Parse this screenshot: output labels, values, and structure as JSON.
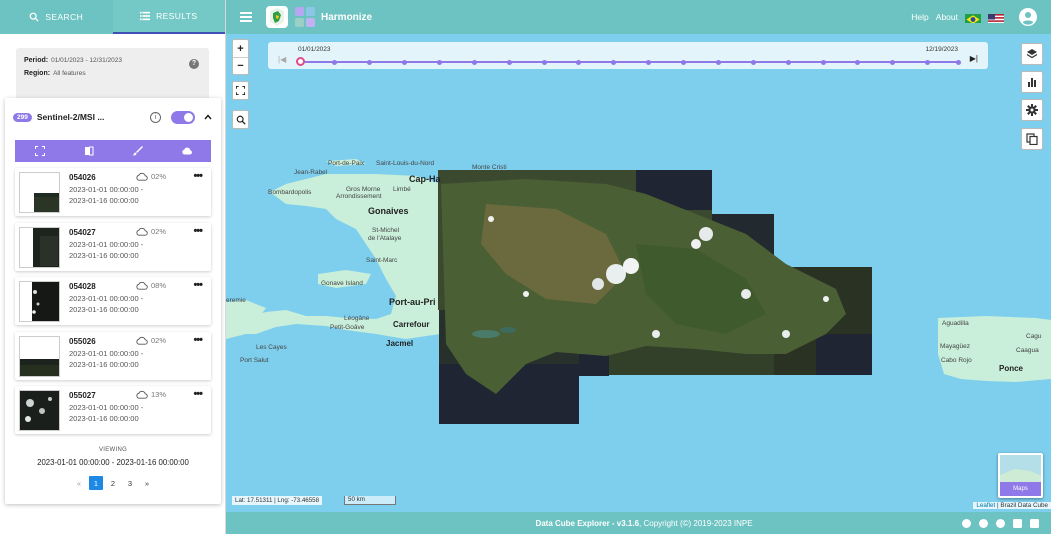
{
  "sidebar": {
    "tabs": [
      {
        "label": "SEARCH",
        "icon": "search-icon"
      },
      {
        "label": "RESULTS",
        "icon": "list-icon"
      }
    ],
    "summary": {
      "period_label": "Period:",
      "period_value": "01/01/2023 - 12/31/2023",
      "region_label": "Region:",
      "region_value": "All features"
    },
    "collection": {
      "count": "299",
      "name": "Sentinel-2/MSI ...",
      "toggle_on": true
    },
    "scenes": [
      {
        "id": "054026",
        "cloud": "02%",
        "start": "2023-01-01 00:00:00 -",
        "end": "2023-01-16 00:00:00"
      },
      {
        "id": "054027",
        "cloud": "02%",
        "start": "2023-01-01 00:00:00 -",
        "end": "2023-01-16 00:00:00"
      },
      {
        "id": "054028",
        "cloud": "08%",
        "start": "2023-01-01 00:00:00 -",
        "end": "2023-01-16 00:00:00"
      },
      {
        "id": "055026",
        "cloud": "02%",
        "start": "2023-01-01 00:00:00 -",
        "end": "2023-01-16 00:00:00"
      },
      {
        "id": "055027",
        "cloud": "13%",
        "start": "2023-01-01 00:00:00 -",
        "end": "2023-01-16 00:00:00"
      }
    ],
    "viewing_label": "VIEWING",
    "viewing_range": "2023-01-01 00:00:00 - 2023-01-16 00:00:00",
    "pagination": {
      "prev": "«",
      "pages": [
        "1",
        "2",
        "3"
      ],
      "current": "1",
      "next": "»"
    }
  },
  "topbar": {
    "title": "Harmonize",
    "help": "Help",
    "about": "About"
  },
  "timeline": {
    "start": "01/01/2023",
    "end": "12/19/2023"
  },
  "map": {
    "zoom_in": "+",
    "zoom_out": "−",
    "labels": {
      "port_de_paix": "Port-de-Paix",
      "saint_louis": "Saint-Louis-du-Nord",
      "monte_cristi": "Monte Cristi",
      "cap_haitien": "Cap-Ha",
      "jean_rabel": "Jean-Rabel",
      "bombardopolis": "Bombardopolis",
      "gros_morne": "Gros Morne",
      "arrondissement": "Arrondissement",
      "limbe": "Limbé",
      "gonaives": "Gonaives",
      "st_michel": "St-Michel",
      "de_l_atalaye": "de l'Atalaye",
      "saint_marc": "Saint-Marc",
      "gonave_island": "Gonave Island",
      "port_au_prince": "Port-au-Pri",
      "carrefour": "Carrefour",
      "jacmel": "Jacmel",
      "petit_goave": "Petit-Goâve",
      "leogane": "Léogâne",
      "jeremie": "eremie",
      "cayes": "Les Cayes",
      "port_salut": "Port Salut",
      "aquadilla": "Aguadilla",
      "cabo_rojo": "Cabo Rojo",
      "mayaguez": "Mayagüez",
      "ponce": "Ponce",
      "cagua": "Caagua",
      "caguas": "Cagu"
    },
    "coords": "Lat: 17.51311 | Lng: -73.46558",
    "scale": "50 km",
    "attribution_leaflet": "Leaflet",
    "attribution_rest": " | Brazil Data Cube",
    "basemap_label": "Maps"
  },
  "footer": {
    "app": "Data Cube Explorer - v3.1.6",
    "copyright": ", Copyright (©) 2019-2023 INPE"
  },
  "colors": {
    "header": "#6cc3c1",
    "accent": "#8f79e8",
    "water": "#7ecfee",
    "land": "#c9eed9"
  }
}
